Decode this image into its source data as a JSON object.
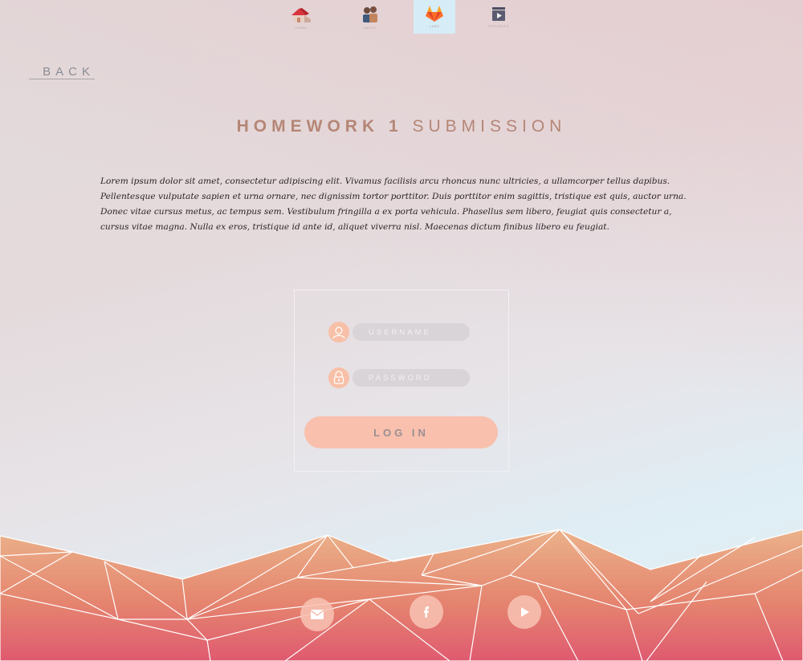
{
  "nav": {
    "items": [
      {
        "label": "Home",
        "icon": "house-icon"
      },
      {
        "label": "About",
        "icon": "people-icon"
      },
      {
        "label": "Labs",
        "icon": "gitlab-fox-icon"
      },
      {
        "label": "Projects",
        "icon": "video-play-icon"
      }
    ],
    "active_index": 2
  },
  "back_label": "BACK",
  "title": {
    "part1": "HOMEWORK 1",
    "part2": "SUBMISSION"
  },
  "description": [
    "Lorem ipsum dolor sit amet, consectetur adipiscing elit. Vivamus facilisis arcu rhoncus nunc ultricies, a ullamcorper tellus dapibus.",
    "Pellentesque vulputate sapien et urna ornare, nec dignissim tortor porttitor. Duis porttitor enim sagittis, tristique est quis, auctor urna.",
    "Donec vitae cursus metus, ac tempus sem. Vestibulum fringilla a ex porta vehicula. Phasellus sem libero, feugiat quis consectetur a,",
    "cursus vitae magna. Nulla ex eros, tristique id ante id, aliquet viverra nisl. Maecenas dictum finibus libero eu feugiat."
  ],
  "login": {
    "username_placeholder": "USERNAME",
    "password_placeholder": "PASSWORD",
    "button_label": "LOG IN"
  },
  "social": [
    {
      "icon": "mail-icon"
    },
    {
      "icon": "facebook-icon"
    },
    {
      "icon": "youtube-play-icon"
    }
  ],
  "colors": {
    "accent": "#f8c0ad",
    "title": "#b58676",
    "active_nav": "#d6ecf6",
    "mountain_top": "#ebb28a",
    "mountain_bottom": "#df5a70"
  }
}
